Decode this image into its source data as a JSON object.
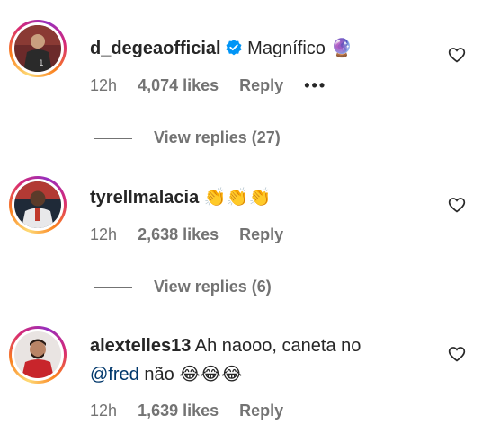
{
  "comments": [
    {
      "username": "d_degeaofficial",
      "verified": true,
      "text": "Magnífico",
      "emoji": "🔮",
      "time": "12h",
      "likes": "4,074 likes",
      "reply": "Reply",
      "more": "•••",
      "view_replies": "View replies (27)"
    },
    {
      "username": "tyrellmalacia",
      "text": "",
      "emoji": "👏👏👏",
      "time": "12h",
      "likes": "2,638 likes",
      "reply": "Reply",
      "view_replies": "View replies (6)"
    },
    {
      "username": "alextelles13",
      "text_line1": "Ah naooo, caneta no",
      "mention": "@fred",
      "text_line2": "não",
      "emoji": "😂😂😂",
      "time": "12h",
      "likes": "1,639 likes",
      "reply": "Reply"
    }
  ],
  "colors": {
    "text": "#262626",
    "meta": "#737373",
    "mention": "#00376b",
    "verified": "#0095f6"
  },
  "icons": [
    "verified-badge-icon",
    "heart-outline-icon",
    "more-options-icon"
  ]
}
